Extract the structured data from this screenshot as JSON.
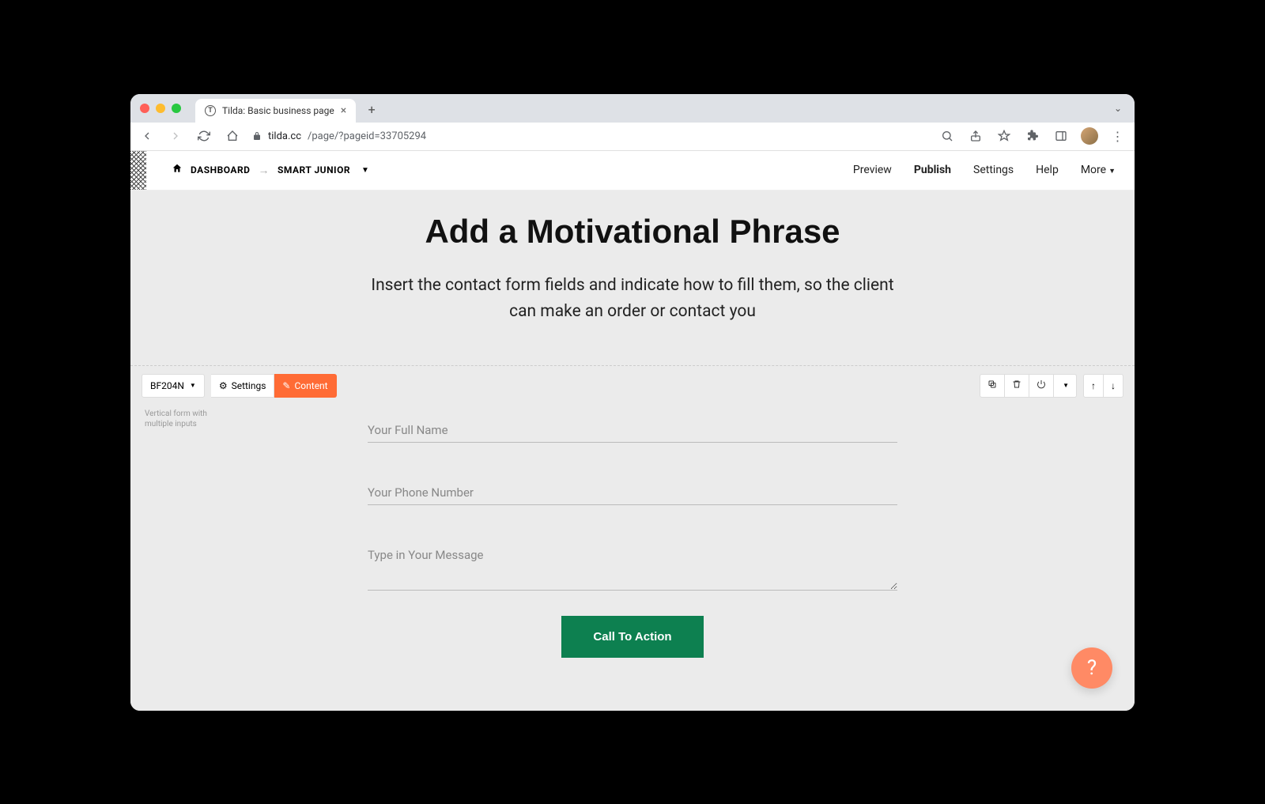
{
  "browser": {
    "tab_title": "Tilda: Basic business page",
    "url_host": "tilda.cc",
    "url_path": "/page/?pageid=33705294"
  },
  "app_header": {
    "dashboard_label": "DASHBOARD",
    "project_name": "SMART JUNIOR",
    "nav": {
      "preview": "Preview",
      "publish": "Publish",
      "settings": "Settings",
      "help": "Help",
      "more": "More"
    }
  },
  "hero": {
    "title": "Add a Motivational Phrase",
    "subtitle": "Insert the contact form fields and indicate how to fill them, so the client can make an order or contact you"
  },
  "block_toolbar": {
    "block_id": "BF204N",
    "settings_label": "Settings",
    "content_label": "Content",
    "description": "Vertical form with multiple inputs"
  },
  "form": {
    "fields": [
      {
        "placeholder": "Your Full Name",
        "type": "text"
      },
      {
        "placeholder": "Your Phone Number",
        "type": "text"
      },
      {
        "placeholder": "Type in Your Message",
        "type": "textarea"
      }
    ],
    "cta_label": "Call To Action"
  },
  "help_fab": "?"
}
